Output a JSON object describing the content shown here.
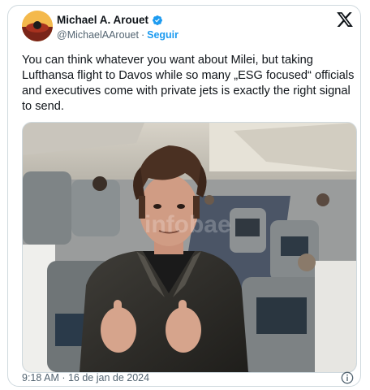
{
  "author": {
    "name": "Michael A. Arouet",
    "handle": "@MichaelAArouet",
    "separator": "·",
    "follow_label": "Seguir",
    "verified": true
  },
  "tweet": {
    "text": "You can think whatever you want about Milei, but taking Lufthansa flight to Davos while so many „ESG focused“ officials and executives come with private jets is exactly the right signal to send."
  },
  "photo": {
    "watermark": "infobae"
  },
  "footer": {
    "timestamp": "9:18 AM · 16 de jan de 2024"
  },
  "colors": {
    "link": "#1d9bf0",
    "secondary_text": "#536471",
    "primary_text": "#0f1419",
    "border": "#cfd9de"
  },
  "icons": [
    "avatar-icon",
    "verified-badge-icon",
    "x-logo-icon",
    "info-icon"
  ]
}
